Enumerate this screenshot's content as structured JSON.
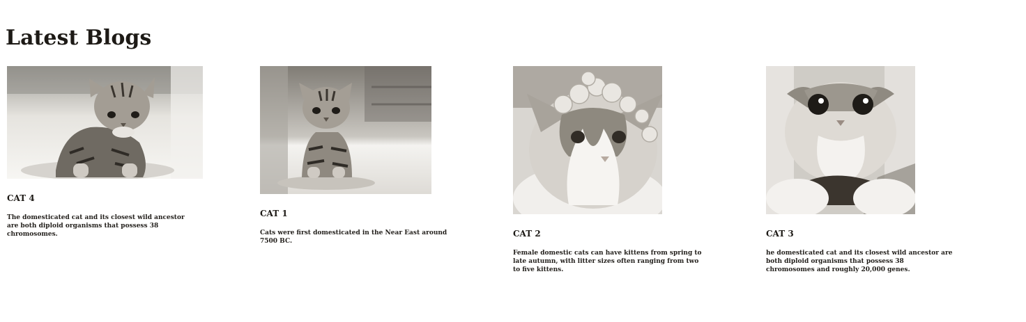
{
  "page": {
    "title": "Latest Blogs"
  },
  "colors": {
    "text": "#1d1a16",
    "background": "#ffffff",
    "image_tint": "#d8d5d0"
  },
  "blogs": [
    {
      "title": "CAT 4",
      "text": "The domesticated cat and its closest wild ancestor are both diploid organisms that possess 38 chromosomes.",
      "image": "kitten-photo"
    },
    {
      "title": "CAT 1",
      "text": "Cats were first domesticated in the Near East around 7500 BC.",
      "image": "sitting-kitten-photo"
    },
    {
      "title": "CAT 2",
      "text": "Female domestic cats can have kittens from spring to late autumn, with litter sizes often ranging from two to five kittens.",
      "image": "cat-with-flower-crown-photo"
    },
    {
      "title": "CAT 3",
      "text": "he domesticated cat and its closest wild ancestor are both diploid organisms that possess 38 chromosomes and roughly 20,000 genes.",
      "image": "scottish-fold-cat-photo"
    }
  ]
}
